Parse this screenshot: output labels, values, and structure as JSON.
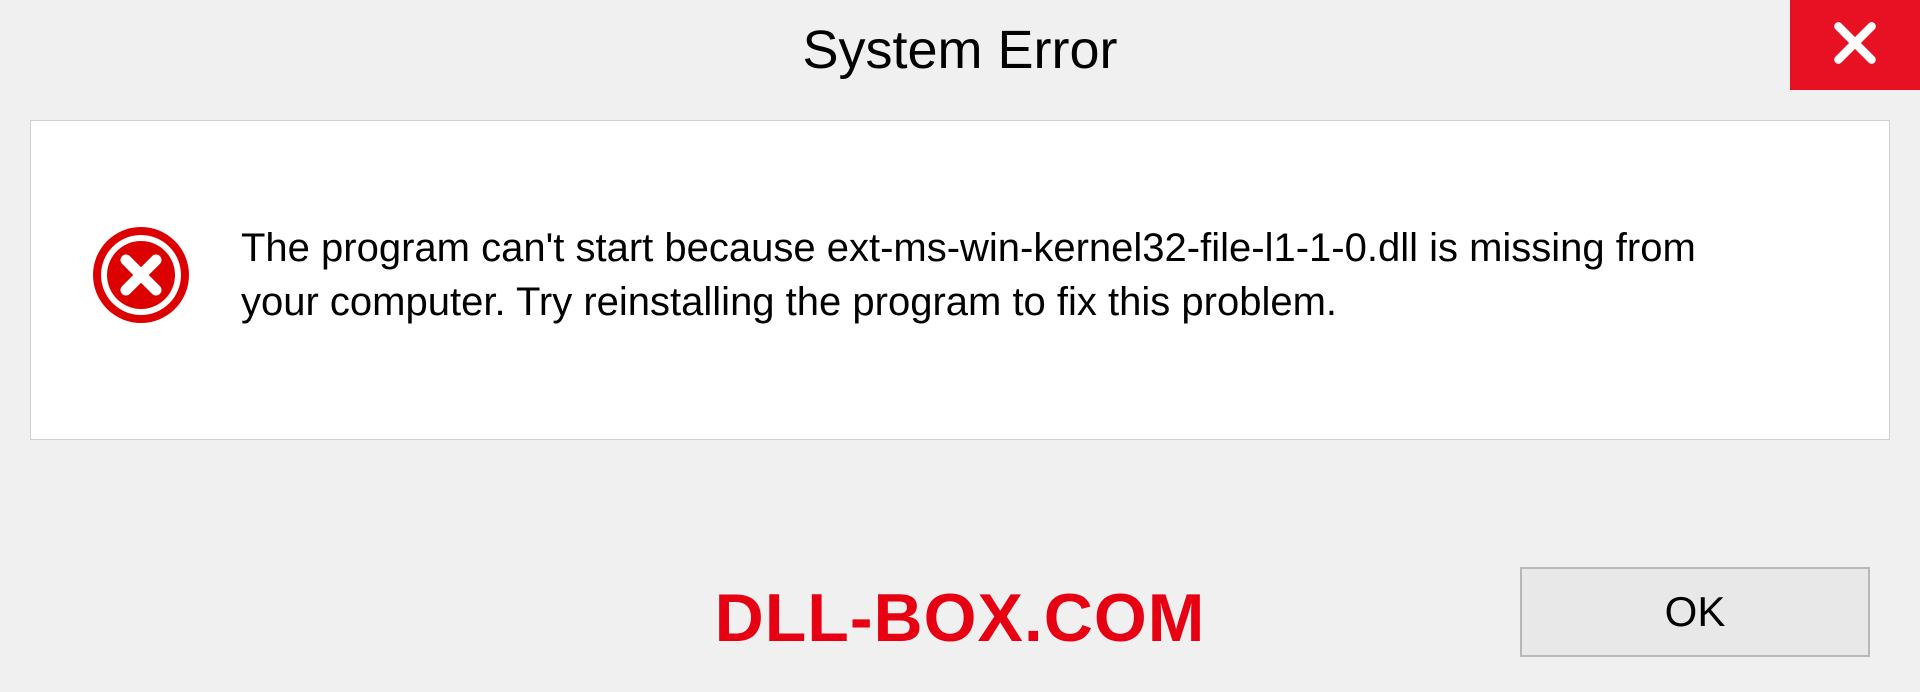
{
  "dialog": {
    "title": "System Error",
    "message": "The program can't start because ext-ms-win-kernel32-file-l1-1-0.dll is missing from your computer. Try reinstalling the program to fix this problem.",
    "ok_label": "OK"
  },
  "watermark": "DLL-BOX.COM",
  "colors": {
    "close_button": "#e81123",
    "error_icon": "#dc0000",
    "watermark_text": "#e60012"
  }
}
